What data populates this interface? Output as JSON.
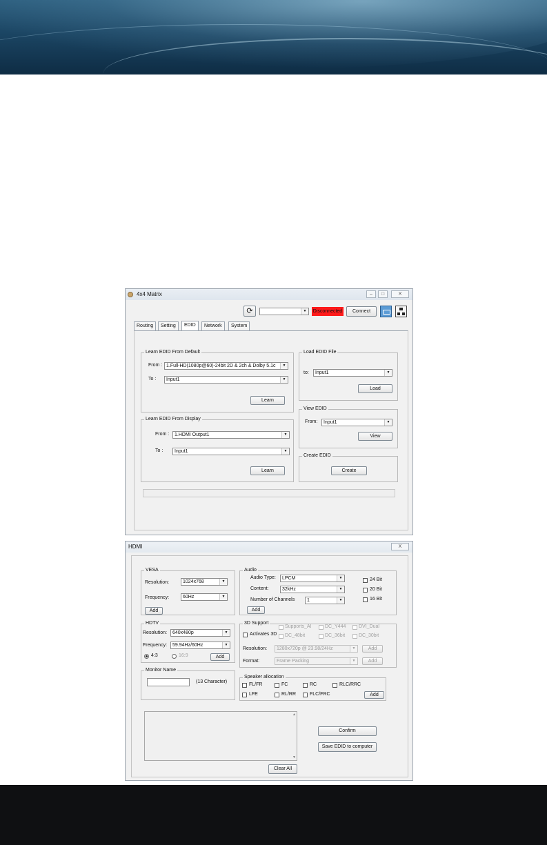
{
  "matrix_window": {
    "title": "4x4 Matrix",
    "port_select_value": "",
    "status": "Disconnected",
    "status_color": "#ff1a1a",
    "connect_label": "Connect",
    "tabs": [
      "Routing",
      "Setting",
      "EDID",
      "Network",
      "System"
    ],
    "active_tab": "EDID",
    "learn_default": {
      "title": "Learn EDID From Default",
      "from_label": "From :",
      "from_value": "1.Full-HD(1080p@60)-24bit 2D & 2ch & Dolby 5.1c",
      "to_label": "To :",
      "to_value": "Input1",
      "learn_label": "Learn"
    },
    "learn_display": {
      "title": "Learn EDID From Display",
      "from_label": "From :",
      "from_value": "1.HDMI Output1",
      "to_label": "To :",
      "to_value": "Input1",
      "learn_label": "Learn"
    },
    "load_edid": {
      "title": "Load EDID File",
      "to_label": "to:",
      "to_value": "Input1",
      "load_label": "Load"
    },
    "view_edid": {
      "title": "View EDID",
      "from_label": "From:",
      "from_value": "Input1",
      "view_label": "View"
    },
    "create_edid": {
      "title": "Create EDID",
      "create_label": "Create"
    }
  },
  "hdmi_window": {
    "title": "HDMI",
    "close_label": "X",
    "vesa": {
      "title": "VESA",
      "resolution_label": "Resolution:",
      "resolution_value": "1024x768",
      "frequency_label": "Frequency:",
      "frequency_value": "60Hz",
      "add_label": "Add"
    },
    "audio": {
      "title": "Audio",
      "type_label": "Audio Type:",
      "type_value": "LPCM",
      "content_label": "Content:",
      "content_value": "32kHz",
      "channels_label": "Number of Channels",
      "channels_value": "1",
      "add_label": "Add",
      "bits": [
        "24 Bit",
        "20 Bit",
        "16 Bit"
      ]
    },
    "hdtv": {
      "title": "HDTV",
      "resolution_label": "Resolution:",
      "resolution_value": "640x480p",
      "frequency_label": "Frequency:",
      "frequency_value": "59.94Hz/60Hz",
      "aspect_options": [
        "4:3",
        "16:9"
      ],
      "aspect_selected": "4:3",
      "add_label": "Add"
    },
    "support3d": {
      "title": "3D Support",
      "activate_label": "Activates 3D",
      "options": [
        "Supports_AI",
        "DC_Y444",
        "DVI_Dual",
        "DC_48bit",
        "DC_36bit",
        "DC_30bit"
      ],
      "resolution_label": "Resolution:",
      "resolution_value": "1280x720p @ 23.98/24Hz",
      "format_label": "Format:",
      "format_value": "Frame Packing",
      "add_label": "Add"
    },
    "monitor_name": {
      "title": "Monitor Name",
      "value": "",
      "hint": "(13 Character)"
    },
    "speaker": {
      "title": "Speaker allocation",
      "row1": [
        "FL/FR",
        "FC",
        "RC",
        "RLC/RRC"
      ],
      "row2": [
        "LFE",
        "RL/RR",
        "FLC/FRC"
      ],
      "add_label": "Add"
    },
    "confirm_label": "Confirm",
    "save_label": "Save EDID to computer",
    "clear_label": "Clear All"
  }
}
